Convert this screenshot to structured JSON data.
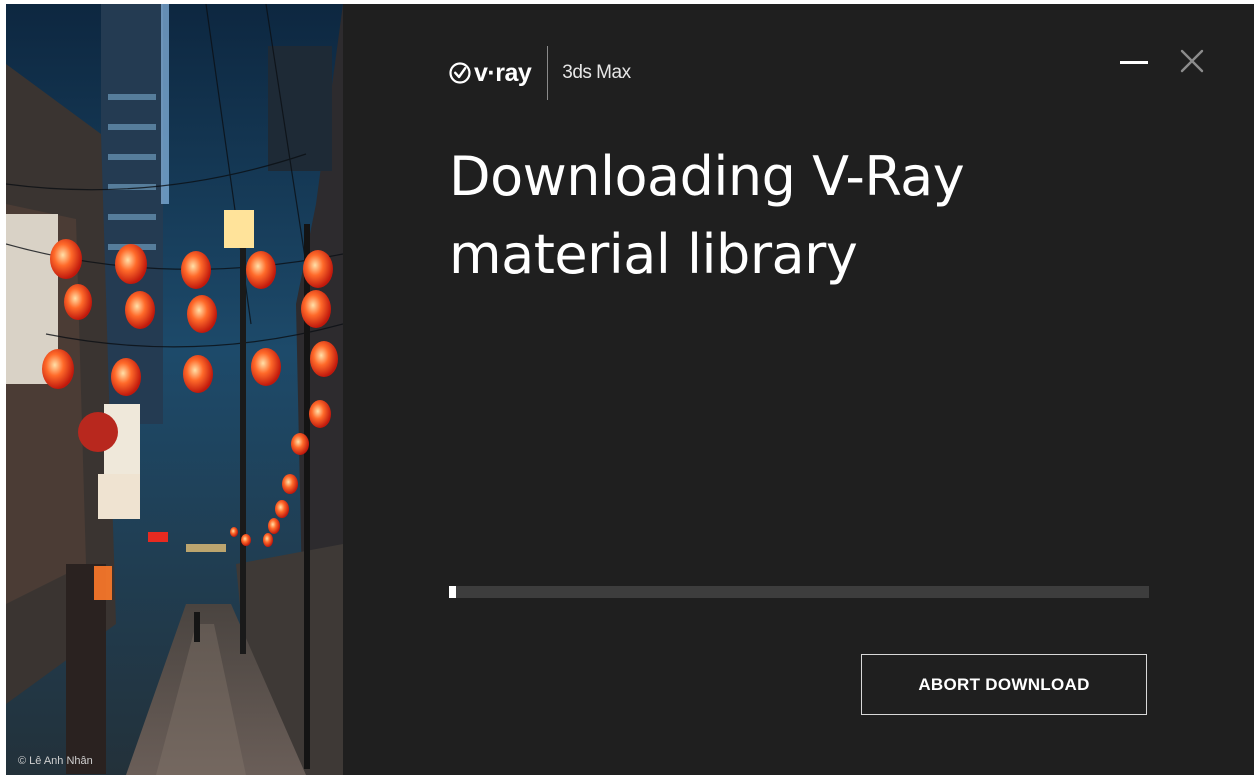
{
  "window": {
    "brand": "v·ray",
    "product": "3ds Max",
    "controls": {
      "minimize_icon": "minimize-icon",
      "close_icon": "close-icon"
    }
  },
  "image": {
    "credit": "© Lê Anh Nhân"
  },
  "main": {
    "title_line1": "Downloading V-Ray",
    "title_line2": "material library",
    "progress": 0.01,
    "abort_label": "ABORT DOWNLOAD"
  },
  "colors": {
    "background": "#1f1f1f",
    "progress_track": "#3d3d3d",
    "progress_fill": "#ffffff",
    "text": "#ffffff"
  }
}
